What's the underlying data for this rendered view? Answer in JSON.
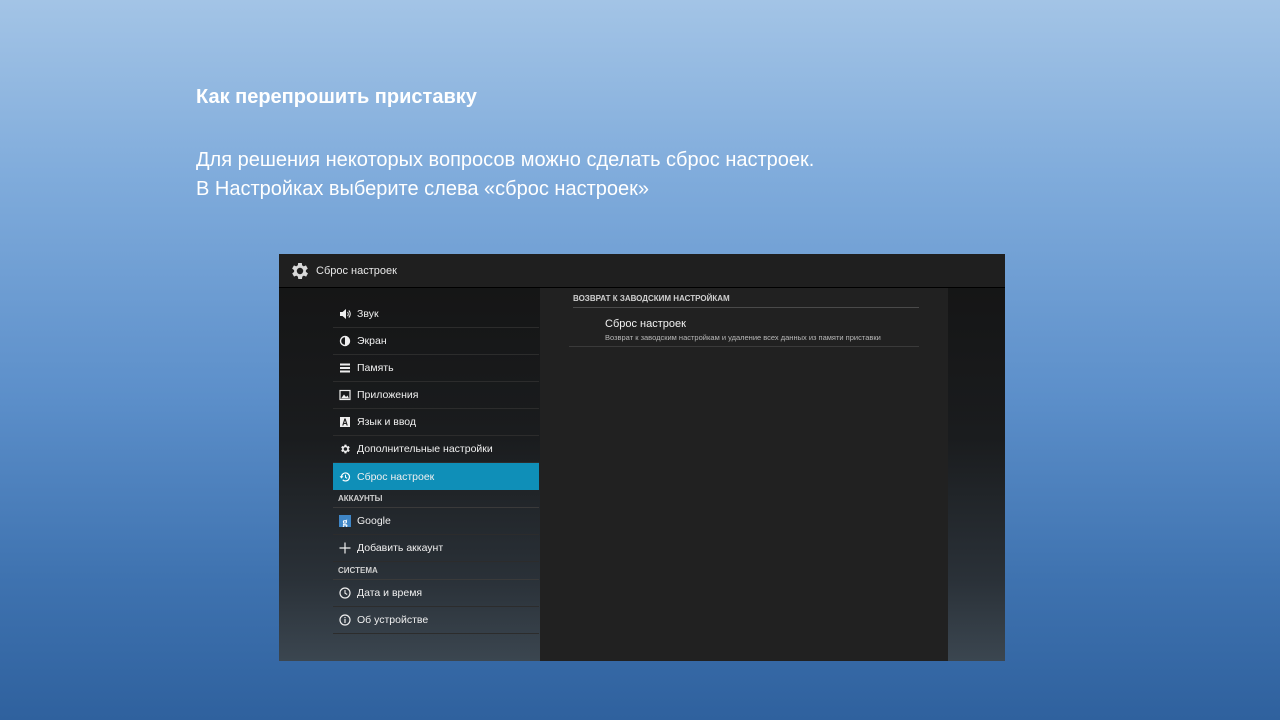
{
  "slide": {
    "title": "Как перепрошить приставку",
    "line1": "Для решения некоторых вопросов можно сделать сброс настроек.",
    "line2": "В Настройках выберите слева «сброс настроек»"
  },
  "screen": {
    "actionbar": {
      "title": "Сброс настроек",
      "icon": "gear-icon"
    },
    "nav": {
      "items": [
        {
          "label": "Звук",
          "icon": "speaker-icon"
        },
        {
          "label": "Экран",
          "icon": "brightness-icon"
        },
        {
          "label": "Память",
          "icon": "storage-icon"
        },
        {
          "label": "Приложения",
          "icon": "apps-icon"
        },
        {
          "label": "Язык и ввод",
          "icon": "language-icon"
        },
        {
          "label": "Дополнительные настройки",
          "icon": "gear-icon"
        },
        {
          "label": "Сброс настроек",
          "icon": "restore-icon",
          "selected": true
        }
      ],
      "accounts_header": "АККАУНТЫ",
      "accounts": [
        {
          "label": "Google",
          "icon": "google-icon"
        },
        {
          "label": "Добавить аккаунт",
          "icon": "plus-icon"
        }
      ],
      "system_header": "СИСТЕМА",
      "system": [
        {
          "label": "Дата и время",
          "icon": "clock-icon"
        },
        {
          "label": "Об устройстве",
          "icon": "info-icon"
        }
      ]
    },
    "content": {
      "section_header": "ВОЗВРАТ К ЗАВОДСКИМ НАСТРОЙКАМ",
      "pref_title": "Сброс настроек",
      "pref_summary": "Возврат к заводским настройкам и удаление всех данных из памяти приставки"
    },
    "colors": {
      "accent": "#0f8fb8",
      "panel": "#212121",
      "actionbar": "#1f1f1f"
    }
  }
}
